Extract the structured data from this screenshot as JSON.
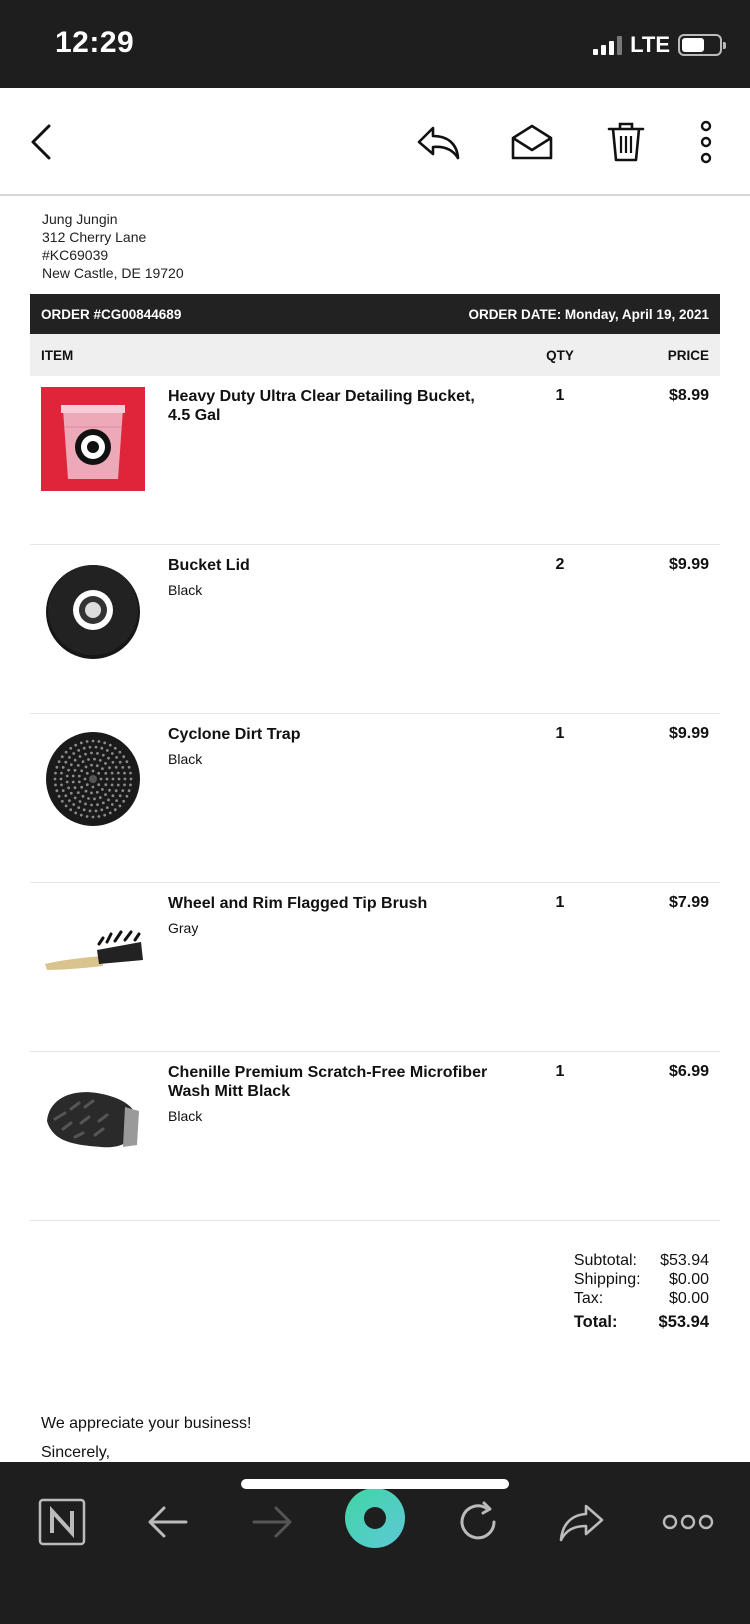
{
  "status": {
    "time": "12:29",
    "network": "LTE",
    "battery_level": 0.6
  },
  "toolbar": {
    "icons": [
      "back-chevron-icon",
      "reply-icon",
      "mark-unread-icon",
      "trash-icon",
      "more-vertical-icon"
    ]
  },
  "customer": {
    "name": "Jung Jungin",
    "street": "312 Cherry Lane",
    "unit": "#KC69039",
    "city": "New Castle, DE 19720"
  },
  "order": {
    "number": "ORDER #CG00844689",
    "date": "ORDER DATE: Monday, April 19, 2021"
  },
  "table_headers": {
    "item": "ITEM",
    "qty": "QTY",
    "price": "PRICE"
  },
  "items": [
    {
      "name": "Heavy Duty Ultra Clear Detailing Bucket, 4.5 Gal",
      "variant": "",
      "qty": "1",
      "price": "$8.99",
      "image": "bucket-image"
    },
    {
      "name": "Bucket Lid",
      "variant": "Black",
      "qty": "2",
      "price": "$9.99",
      "image": "bucket-lid-image"
    },
    {
      "name": "Cyclone Dirt Trap",
      "variant": "Black",
      "qty": "1",
      "price": "$9.99",
      "image": "dirt-trap-image"
    },
    {
      "name": "Wheel and Rim Flagged Tip Brush",
      "variant": "Gray",
      "qty": "1",
      "price": "$7.99",
      "image": "brush-image"
    },
    {
      "name": "Chenille Premium Scratch-Free Microfiber Wash Mitt Black",
      "variant": "Black",
      "qty": "1",
      "price": "$6.99",
      "image": "wash-mitt-image"
    }
  ],
  "totals": {
    "subtotal_label": "Subtotal:",
    "subtotal": "$53.94",
    "shipping_label": "Shipping:",
    "shipping": "$0.00",
    "tax_label": "Tax:",
    "tax": "$0.00",
    "total_label": "Total:",
    "total": "$53.94"
  },
  "closing": {
    "line1": "We appreciate your business!",
    "line2": "Sincerely,"
  },
  "browser_bar": {
    "icons": [
      "notion-logo-icon",
      "back-arrow-icon",
      "forward-arrow-icon",
      "home-circle-icon",
      "reload-icon",
      "share-icon",
      "more-horizontal-icon"
    ]
  },
  "colors": {
    "header_bg": "#222222",
    "table_header_bg": "#efefef",
    "system_bar_bg": "#1e1e1e",
    "accent": "#4ecf9f"
  }
}
